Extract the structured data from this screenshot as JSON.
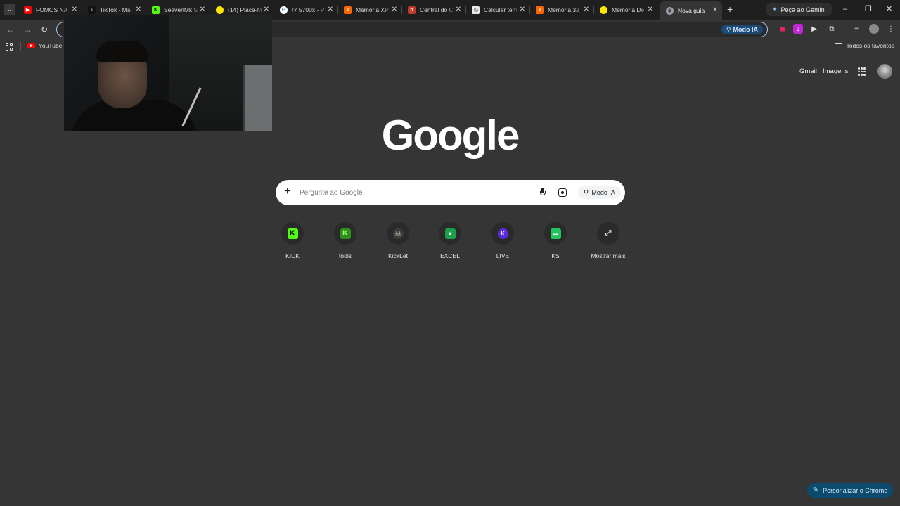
{
  "tabs": [
    {
      "title": "FOMOS NA",
      "favicon": "youtube-icon",
      "color": "#ff0000"
    },
    {
      "title": "TikTok - Ma",
      "favicon": "tiktok-icon",
      "color": "#111111"
    },
    {
      "title": "SeevenMk S",
      "favicon": "kick-icon",
      "color": "#53fc18"
    },
    {
      "title": "(14) Placa-M",
      "favicon": "mercadolivre-icon",
      "color": "#ffe600"
    },
    {
      "title": "r7 5700x - P",
      "favicon": "google-icon",
      "color": "#4285f4"
    },
    {
      "title": "Memória XP",
      "favicon": "kabum-icon",
      "color": "#ff6500"
    },
    {
      "title": "Central do C",
      "favicon": "pichau-icon",
      "color": "#c0392b"
    },
    {
      "title": "Calcular tem",
      "favicon": "calc-icon",
      "color": "#e8eaed"
    },
    {
      "title": "Memória 32",
      "favicon": "kabum-icon",
      "color": "#ff6500"
    },
    {
      "title": "Memória De",
      "favicon": "mercadolivre-icon",
      "color": "#ffe600"
    },
    {
      "title": "Nova guia",
      "favicon": "chrome-icon",
      "color": "#9aa0a6",
      "active": true
    }
  ],
  "gemini_button": "Peça ao Gemini",
  "omnibox": {
    "value": "",
    "modo_ia": "Modo IA"
  },
  "bookmarks": {
    "youtube": "YouTube",
    "all_favorites": "Todos os favoritos"
  },
  "top_links": {
    "gmail": "Gmail",
    "images": "Imagens"
  },
  "logo": "Google",
  "search": {
    "placeholder": "Pergunte ao Google",
    "modo_ia": "Modo IA"
  },
  "shortcuts": [
    {
      "label": "KICK",
      "bg": "#53fc18",
      "glyph": "K",
      "fg": "#000000"
    },
    {
      "label": "tools",
      "bg": "#2f8f1a",
      "glyph": "K",
      "fg": "#9dff6e"
    },
    {
      "label": "KickLet",
      "bg": "#3d3d3d",
      "glyph": "☠",
      "fg": "#cfe8c0"
    },
    {
      "label": "EXCEL",
      "bg": "#1e9e4a",
      "glyph": "x",
      "fg": "#ffffff"
    },
    {
      "label": "LIVE",
      "bg": "#5b2be0",
      "glyph": "K",
      "fg": "#ffffff"
    },
    {
      "label": "KS",
      "bg": "#22c55e",
      "glyph": "▬",
      "fg": "#ffffff"
    },
    {
      "label": "Mostrar mais",
      "bg": "transparent",
      "glyph": "⤢",
      "fg": "#e3e3e3"
    }
  ],
  "customize_button": "Personalizar o Chrome",
  "colors": {
    "page_bg": "#353535",
    "tabstrip_bg": "#1f1f1f",
    "accent": "#a8c7fa",
    "customize_bg": "#0c4a6e"
  }
}
